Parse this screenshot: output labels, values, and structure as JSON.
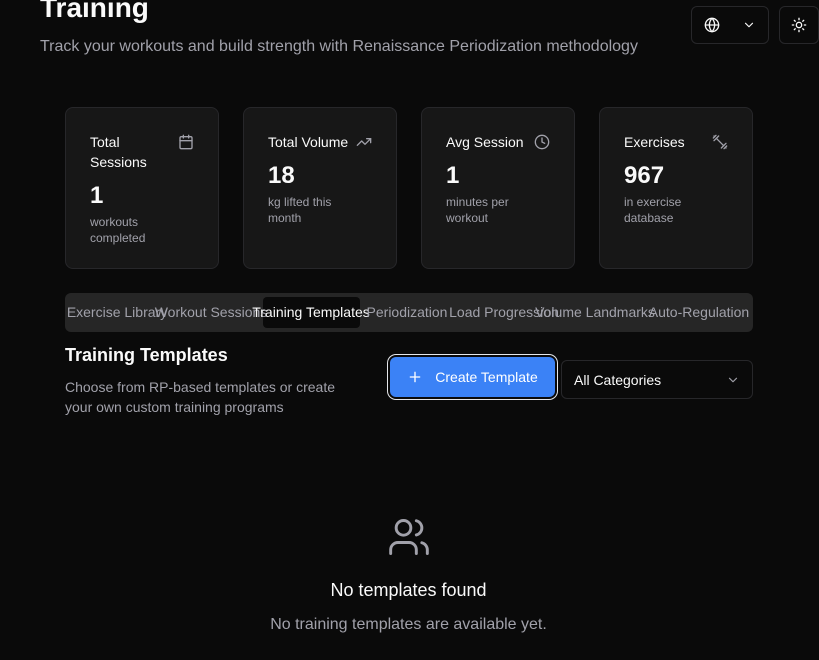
{
  "header": {
    "title": "Training",
    "subtitle": "Track your workouts and build strength with Renaissance Periodization methodology"
  },
  "toolbar": {
    "language_icon": "globe-icon",
    "theme_icon": "sun-icon"
  },
  "stats": [
    {
      "title": "Total Sessions",
      "value": "1",
      "description": "workouts completed",
      "icon": "calendar-icon"
    },
    {
      "title": "Total Volume",
      "value": "18",
      "description": "kg lifted this month",
      "icon": "trending-up-icon"
    },
    {
      "title": "Avg Session",
      "value": "1",
      "description": "minutes per workout",
      "icon": "clock-icon"
    },
    {
      "title": "Exercises",
      "value": "967",
      "description": "in exercise database",
      "icon": "dumbbell-icon"
    }
  ],
  "tabs": [
    {
      "label": "Exercise Library"
    },
    {
      "label": "Workout Sessions"
    },
    {
      "label": "Training Templates",
      "active": true
    },
    {
      "label": "Periodization"
    },
    {
      "label": "Load Progression"
    },
    {
      "label": "Volume Landmarks"
    },
    {
      "label": "Auto-Regulation"
    }
  ],
  "templates": {
    "title": "Training Templates",
    "description": "Choose from RP-based templates or create your own custom training programs",
    "create_label": "Create Template",
    "category_value": "All Categories",
    "empty_title": "No templates found",
    "empty_description": "No training templates are available yet."
  },
  "colors": {
    "background": "#0a0a0a",
    "card": "#171717",
    "accent": "#3b82f6",
    "muted_text": "#a1a1aa"
  }
}
